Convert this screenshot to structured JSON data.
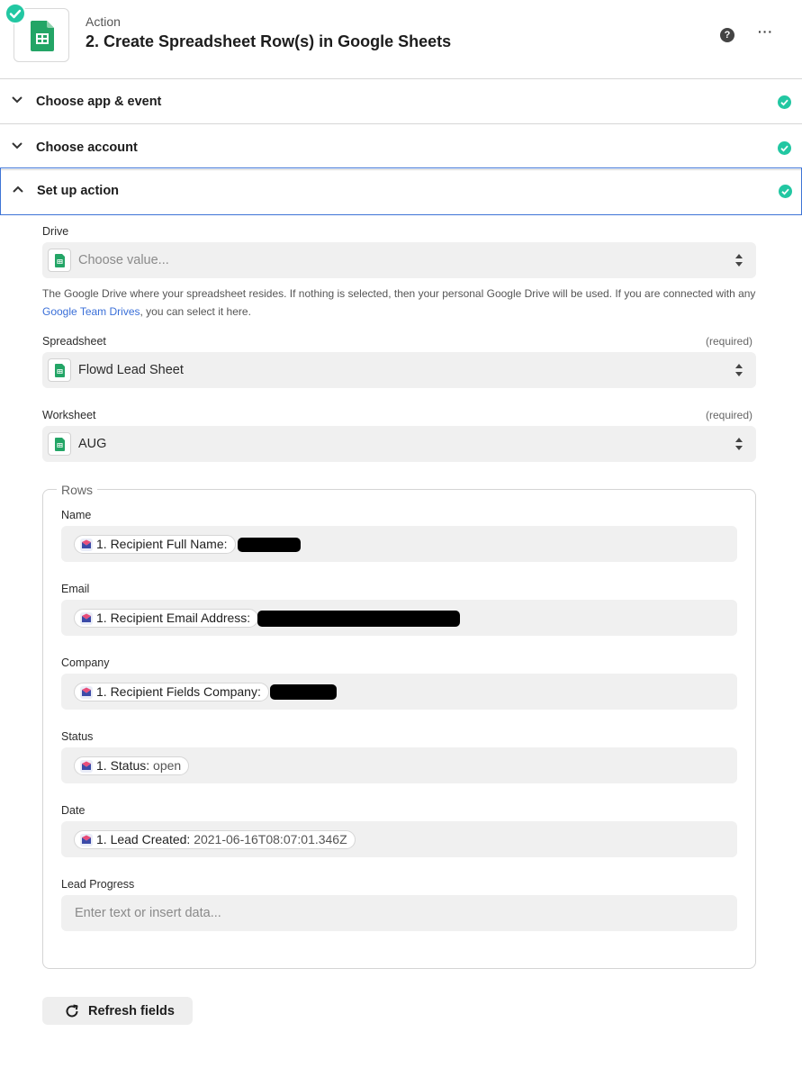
{
  "header": {
    "kicker": "Action",
    "title": "2. Create Spreadsheet Row(s) in Google Sheets",
    "help_icon": "question-icon",
    "more_icon": "more-horizontal-icon",
    "more_label": "···"
  },
  "sections": [
    {
      "label": "Choose app & event",
      "state": "complete"
    },
    {
      "label": "Choose account",
      "state": "complete"
    },
    {
      "label": "Set up action",
      "state": "complete",
      "expanded": true
    }
  ],
  "fields": {
    "drive": {
      "label": "Drive",
      "placeholder": "Choose value..."
    },
    "drive_help_prefix": "The Google Drive where your spreadsheet resides. If nothing is selected, then your personal Google Drive will be used. If you are connected with any ",
    "drive_help_link": "Google Team Drives",
    "drive_help_suffix": ", you can select it here.",
    "spreadsheet": {
      "label": "Spreadsheet",
      "required": "(required)",
      "value": "Flowd Lead Sheet"
    },
    "worksheet": {
      "label": "Worksheet",
      "required": "(required)",
      "value": "AUG"
    }
  },
  "rows": {
    "legend": "Rows",
    "name": {
      "label": "Name",
      "token_key": "1. Recipient Full Name:",
      "token_value": ""
    },
    "email": {
      "label": "Email",
      "token_key": "1. Recipient Email Address:",
      "token_value": ""
    },
    "company": {
      "label": "Company",
      "token_key": "1. Recipient Fields Company:",
      "token_value": ""
    },
    "status": {
      "label": "Status",
      "token_key": "1. Status:",
      "token_value": "open"
    },
    "date": {
      "label": "Date",
      "token_key": "1. Lead Created:",
      "token_value": "2021-06-16T08:07:01.346Z"
    },
    "lead_progress": {
      "label": "Lead Progress",
      "placeholder": "Enter text or insert data..."
    }
  },
  "refresh_label": "Refresh fields",
  "colors": {
    "accent_green": "#22c7a2",
    "active_border": "#3e74d6",
    "sheets_green": "#23a566",
    "link": "#3a6fd8"
  }
}
